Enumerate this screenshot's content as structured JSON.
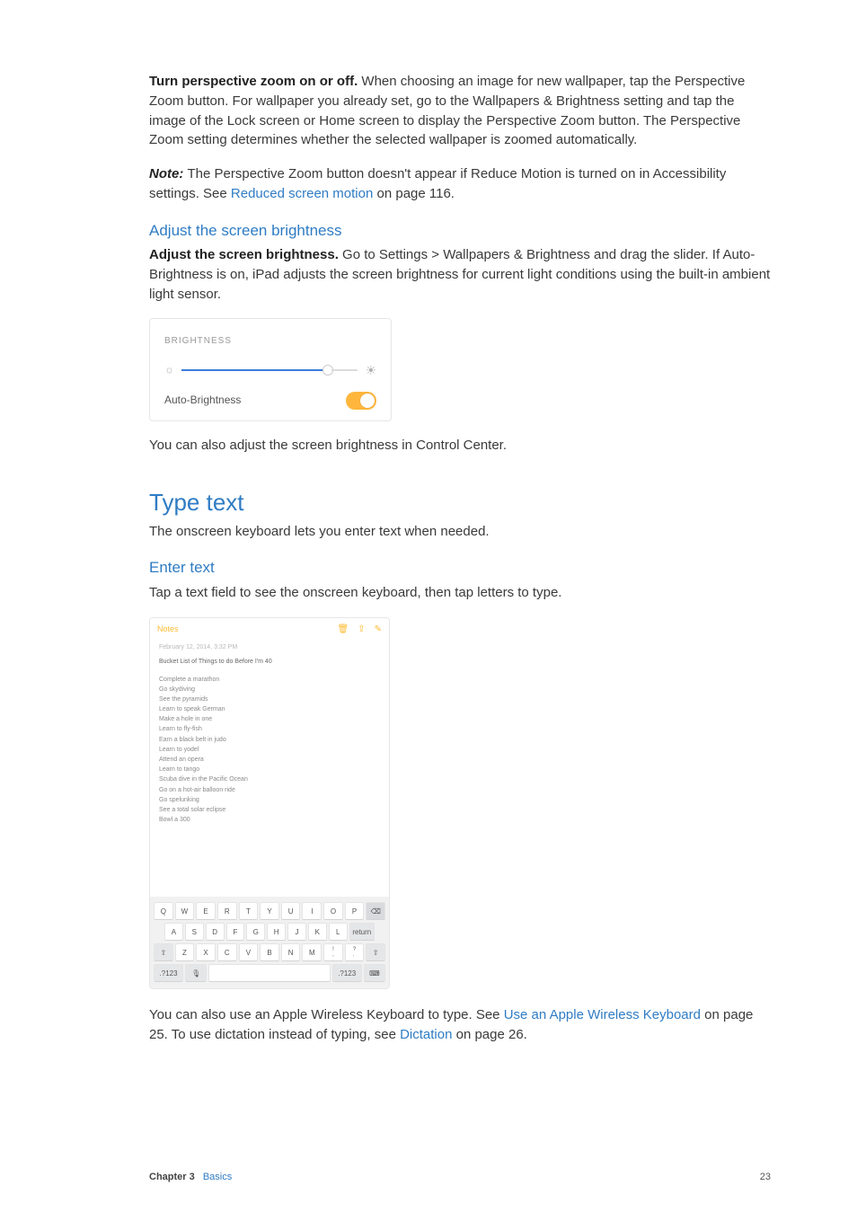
{
  "intro": {
    "strong": "Turn perspective zoom on or off.",
    "rest": " When choosing an image for new wallpaper, tap the Perspective Zoom button. For wallpaper you already set, go to the Wallpapers & Brightness setting and tap the image of the Lock screen or Home screen to display the Perspective Zoom button. The Perspective Zoom setting determines whether the selected wallpaper is zoomed automatically."
  },
  "note": {
    "label": "Note:  ",
    "body": "The Perspective Zoom button doesn't appear if Reduce Motion is turned on in Accessibility settings. See ",
    "link": "Reduced screen motion",
    "tail": " on page 116."
  },
  "brightness": {
    "heading": "Adjust the screen brightness",
    "strong": "Adjust the screen brightness.",
    "body": " Go to Settings > Wallpapers & Brightness and drag the slider. If Auto-Brightness is on, iPad adjusts the screen brightness for current light conditions using the built-in ambient light sensor.",
    "panel_header": "BRIGHTNESS",
    "auto_label": "Auto-Brightness",
    "after": "You can also adjust the screen brightness in Control Center."
  },
  "typetext": {
    "heading": "Type text",
    "sub": "The onscreen keyboard lets you enter text when needed."
  },
  "entertext": {
    "heading": "Enter text",
    "body": "Tap a text field to see the onscreen keyboard, then tap letters to type."
  },
  "notesfig": {
    "app": "Notes",
    "date": "February 12, 2014, 3:32 PM",
    "title": "Bucket List of Things to do Before I'm 40",
    "items": [
      "Complete a marathon",
      "Go skydiving",
      "See the pyramids",
      "Learn to speak German",
      "Make a hole in one",
      "Learn to fly-fish",
      "Earn a black belt in judo",
      "Learn to yodel",
      "Attend an opera",
      "Learn to tango",
      "Scuba dive in the Pacific Ocean",
      "Go on a hot-air balloon ride",
      "Go spelunking",
      "See a total solar eclipse",
      "Bowl a 300"
    ]
  },
  "kbd": {
    "row1": [
      "Q",
      "W",
      "E",
      "R",
      "T",
      "Y",
      "U",
      "I",
      "O",
      "P"
    ],
    "row2": [
      "A",
      "S",
      "D",
      "F",
      "G",
      "H",
      "J",
      "K",
      "L"
    ],
    "row3": [
      "Z",
      "X",
      "C",
      "V",
      "B",
      "N",
      "M",
      "!",
      ",",
      "?",
      "."
    ],
    "del": "⌫",
    "shift": "⇧",
    "return": "return",
    "numkey": ".?123",
    "mic": "🎤",
    "hide": "⌨"
  },
  "after_kbd": {
    "pre": "You can also use an Apple Wireless Keyboard to type. See ",
    "link1": "Use an Apple Wireless Keyboard",
    "mid": " on page 25. To use dictation instead of typing, see ",
    "link2": "Dictation",
    "tail": " on page 26."
  },
  "footer": {
    "chapter_label": "Chapter 3",
    "chapter_name": "Basics",
    "page": "23"
  }
}
